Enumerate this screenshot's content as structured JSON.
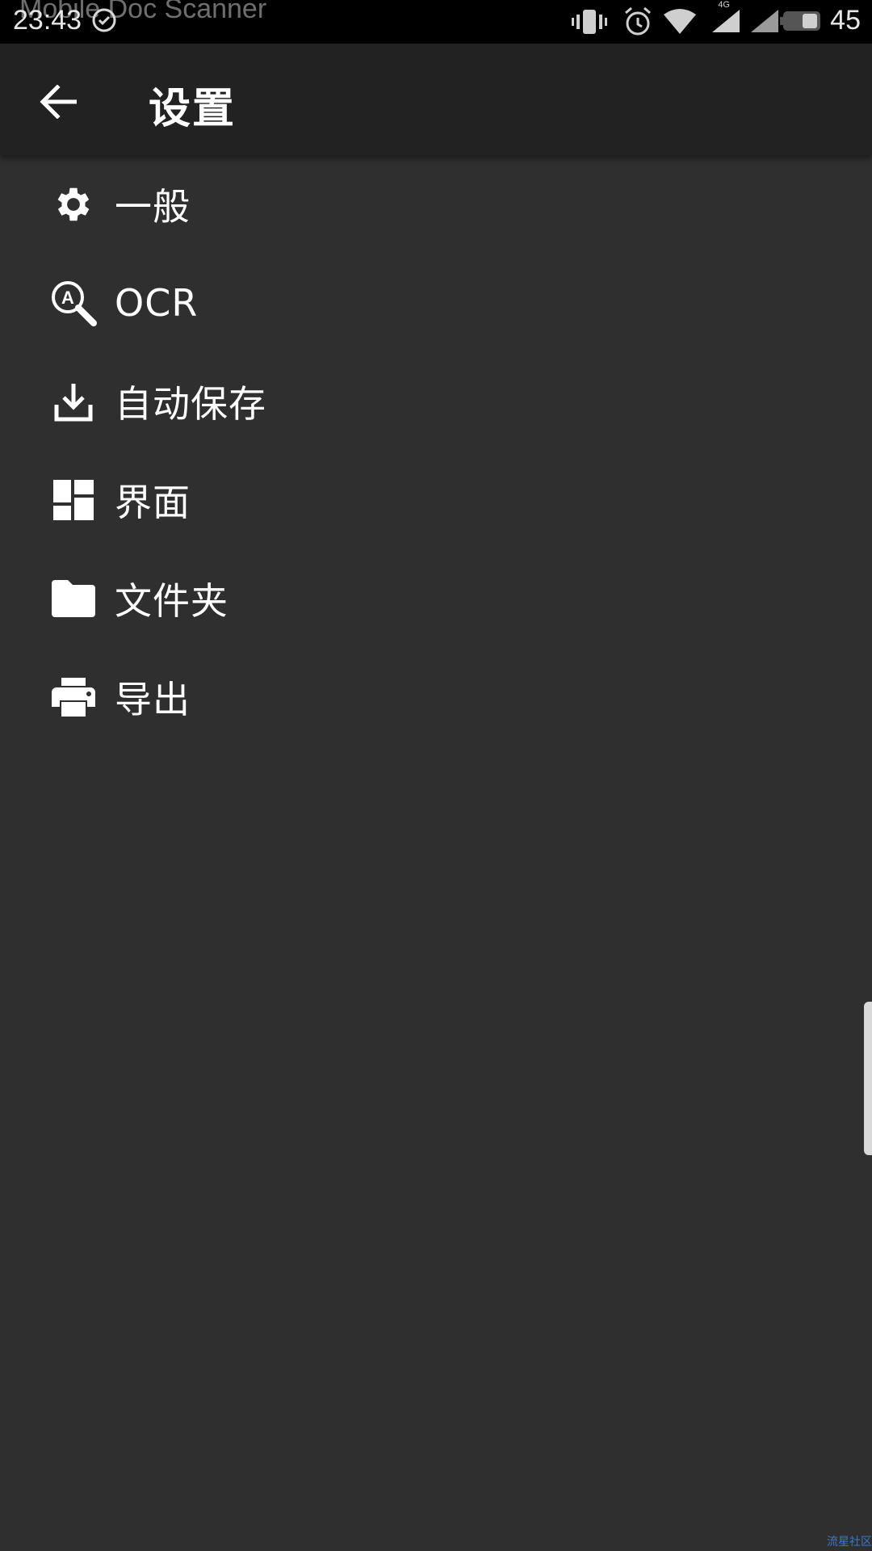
{
  "status_bar": {
    "time": "23:43",
    "notification_ghost": "Mobile Doc Scanner",
    "network_label": "4G",
    "battery_percent": "45",
    "icons": [
      "sync-icon",
      "vibrate-icon",
      "alarm-icon",
      "wifi-icon",
      "signal-icon",
      "signal-icon",
      "battery-icon"
    ]
  },
  "app_bar": {
    "title": "设置",
    "back_icon": "arrow-back-icon"
  },
  "menu": {
    "items": [
      {
        "label": "一般",
        "icon": "gear-icon"
      },
      {
        "label": "OCR",
        "icon": "ocr-search-icon"
      },
      {
        "label": "自动保存",
        "icon": "download-icon"
      },
      {
        "label": "界面",
        "icon": "dashboard-icon"
      },
      {
        "label": "文件夹",
        "icon": "folder-icon"
      },
      {
        "label": "导出",
        "icon": "printer-icon"
      }
    ]
  },
  "watermark": "流星社区",
  "colors": {
    "background": "#2f2f2f",
    "app_bar": "#222222",
    "status_bar": "#000000",
    "text": "#ffffff"
  }
}
